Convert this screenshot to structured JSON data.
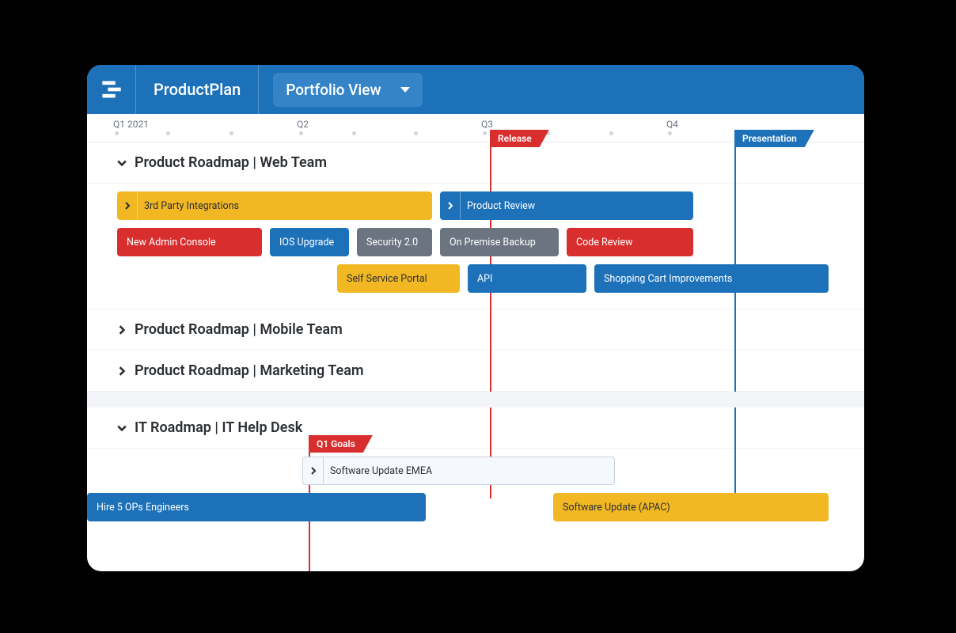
{
  "header": {
    "brand": "ProductPlan",
    "dropdown_label": "Portfolio View"
  },
  "timeline": {
    "q1": "Q1 2021",
    "q2": "Q2",
    "q3": "Q3",
    "q4": "Q4"
  },
  "markers": {
    "release": "Release",
    "presentation": "Presentation",
    "q1_goals": "Q1 Goals"
  },
  "sections": {
    "web": "Product Roadmap | Web Team",
    "mobile": "Product Roadmap | Mobile Team",
    "marketing": "Product Roadmap | Marketing Team",
    "it": "IT Roadmap | IT Help Desk"
  },
  "bars": {
    "third_party": "3rd Party Integrations",
    "product_review": "Product Review",
    "new_admin": "New Admin Console",
    "ios_upgrade": "IOS Upgrade",
    "security": "Security 2.0",
    "on_premise": "On Premise Backup",
    "code_review": "Code Review",
    "self_service": "Self Service Portal",
    "api": "API",
    "shopping_cart": "Shopping Cart Improvements",
    "software_emea": "Software Update EMEA",
    "hire_ops": "Hire 5 OPs Engineers",
    "software_apac": "Software Update (APAC)"
  },
  "colors": {
    "primary_blue": "#1c71b9",
    "red": "#d92e2e",
    "yellow": "#f2b823",
    "gray": "#6b7480"
  }
}
